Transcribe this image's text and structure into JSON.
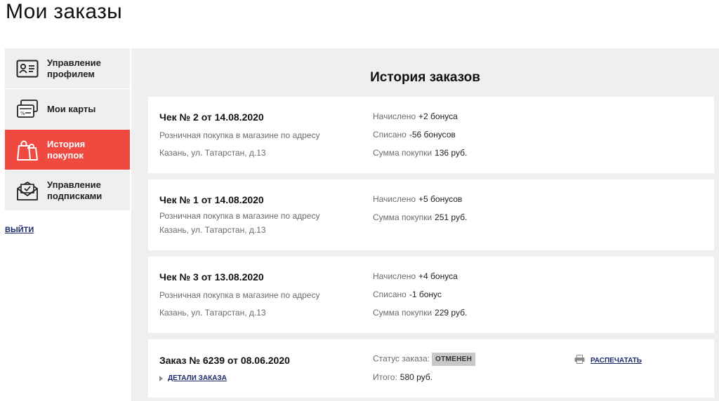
{
  "page": {
    "title": "Мои заказы"
  },
  "sidebar": {
    "items": [
      {
        "label": "Управление профилем",
        "icon": "profile-card-icon",
        "active": false
      },
      {
        "label": "Мои карты",
        "icon": "discount-cards-icon",
        "active": false
      },
      {
        "label": "История покупок",
        "icon": "shopping-bags-icon",
        "active": true
      },
      {
        "label": "Управление подписками",
        "icon": "envelope-icon",
        "active": false
      }
    ],
    "logout": "ВЫЙТИ"
  },
  "main": {
    "title": "История заказов",
    "receipts": [
      {
        "title": "Чек № 2 от 14.08.2020",
        "desc": "Розничная покупка в магазине по адресу",
        "address": "Казань, ул. Татарстан, д.13",
        "rows": [
          {
            "label": "Начислено",
            "value": "+2 бонуса"
          },
          {
            "label": "Списано",
            "value": "-56 бонусов"
          },
          {
            "label": "Сумма покупки",
            "value": "136 руб."
          }
        ]
      },
      {
        "title": "Чек № 1 от 14.08.2020",
        "desc": "Розничная покупка в магазине по адресу",
        "address": "Казань, ул. Татарстан, д.13",
        "rows": [
          {
            "label": "Начислено",
            "value": "+5 бонусов"
          },
          {
            "label": "Сумма покупки",
            "value": "251 руб."
          }
        ]
      },
      {
        "title": "Чек № 3 от 13.08.2020",
        "desc": "Розничная покупка в магазине по адресу",
        "address": "Казань, ул. Татарстан, д.13",
        "rows": [
          {
            "label": "Начислено",
            "value": "+4 бонуса"
          },
          {
            "label": "Списано",
            "value": "-1 бонус"
          },
          {
            "label": "Сумма покупки",
            "value": "229 руб."
          }
        ]
      }
    ],
    "order": {
      "title": "Заказ № 6239 от 08.06.2020",
      "status_label": "Статус заказа:",
      "status_value": "ОТМЕНЕН",
      "total_label": "Итого:",
      "total_value": "580 руб.",
      "details_link": "ДЕТАЛИ ЗАКАЗА",
      "print_link": "РАСПЕЧАТАТЬ",
      "print_icon": "printer-icon",
      "details_icon": "triangle-right-icon"
    }
  },
  "colors": {
    "accent": "#f04a40",
    "link": "#1a2a6b",
    "panel": "#efefef",
    "badge": "#c8c8c8"
  }
}
